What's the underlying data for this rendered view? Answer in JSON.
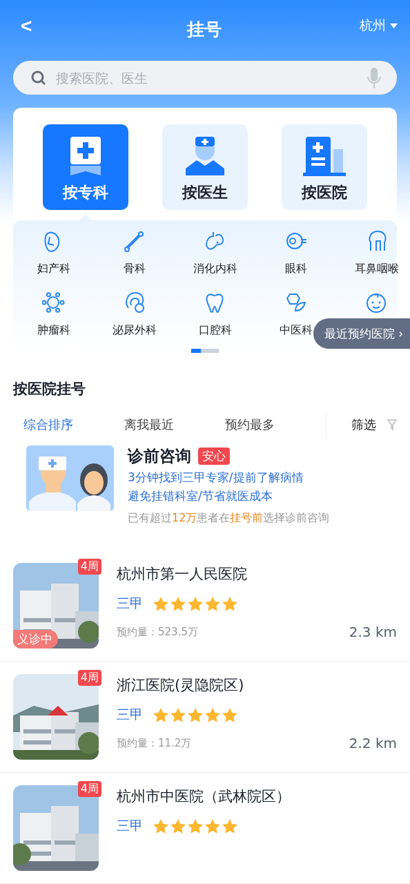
{
  "header": {
    "back": "<",
    "title": "挂号",
    "city": "杭州"
  },
  "search": {
    "placeholder": "搜索医院、医生"
  },
  "modes": [
    {
      "label": "按专科",
      "selected": true
    },
    {
      "label": "按医生",
      "selected": false
    },
    {
      "label": "按医院",
      "selected": false
    }
  ],
  "departments": [
    "妇产科",
    "骨科",
    "消化内科",
    "眼科",
    "耳鼻咽喉",
    "肿瘤科",
    "泌尿外科",
    "口腔科",
    "中医科"
  ],
  "pager": {
    "level": 0.35
  },
  "recent_button": "最近预约医院 ›",
  "section_title": "按医院挂号",
  "sort_tabs": [
    {
      "label": "综合排序",
      "selected": true
    },
    {
      "label": "离我最近",
      "selected": false
    },
    {
      "label": "预约最多",
      "selected": false
    }
  ],
  "filter": "筛选",
  "consult": {
    "title": "诊前咨询",
    "tag": "安心",
    "line1": "3分钟找到三甲专家/提前了解病情",
    "line2": "避免挂错科室/节省就医成本",
    "note": "已有超过**12万**患者在**挂号前**选择诊前咨询"
  },
  "hospitals": [
    {
      "name": "杭州市第一人民医院",
      "badge": "4周",
      "event": "义诊中",
      "level": "三甲",
      "stars": 5,
      "volume": "预约量：523.5万",
      "distance": "2.3 km"
    },
    {
      "name": "浙江医院(灵隐院区)",
      "badge": "4周",
      "level": "三甲",
      "stars": 5,
      "volume": "预约量：11.2万",
      "distance": "2.2 km"
    },
    {
      "name": "杭州市中医院（武林院区）",
      "badge": "4周",
      "level": "三甲",
      "stars": 5
    }
  ]
}
